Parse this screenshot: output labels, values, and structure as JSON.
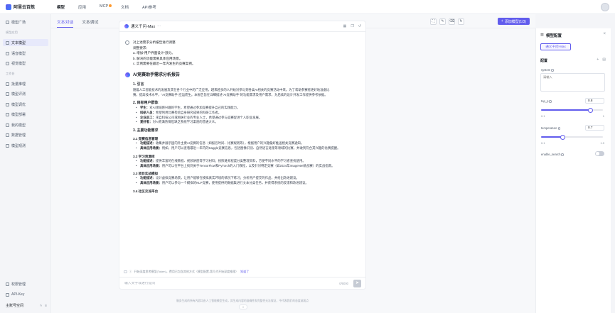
{
  "app": {
    "name": "阿里云百炼"
  },
  "topnav": [
    "模型",
    "应用",
    "MCP",
    "文档",
    "API参考"
  ],
  "sidebar": {
    "item_market": "模型广场",
    "section_debug": "模型应用",
    "debug_items": [
      "文本模型",
      "语音模型",
      "视觉模型"
    ],
    "section_tools": "工作台",
    "tool_items": [
      "批量推理",
      "模型评测",
      "模型调优",
      "模型部署",
      "我的模型",
      "数据管理",
      "模型观测"
    ],
    "footer_items": [
      "权限管理",
      "API-Key"
    ],
    "workspace": "主账号空间"
  },
  "tabs": [
    "文本对话",
    "文本调试"
  ],
  "toolbar": {
    "add_model_label": "添加模型(1/3)"
  },
  "chat": {
    "model_name": "通义千问-Max",
    "user_message": [
      "对上述需求分析报告进行调整",
      "调整要求：",
      "a. 增加\"用户界面设计\"部分。",
      "b. 解决的功能需要具体应用场景。",
      "c. 实例需要在最近一年内发生的竞赛案例。"
    ],
    "ai": {
      "title": "AI竞赛助手需求分析报告",
      "s1": "1. 引言",
      "s1_text": [
        "随着人工智能技术的发展及其在各个行业中的广泛应用，越来越多的人开始对参与到各类AI相关的竞赛活动中来。为了帮助参赛者更好地准备比",
        "赛，提高技术水平，\"AI竞赛助手\"应运而生。本报告旨在详细描述\"AI竞赛助手\"的功能需求及用户需求，为后续的设计开发工作提供参考依据。"
      ],
      "s2": "2. 目标用户群体",
      "s2_items": [
        {
          "k": "学生：",
          "v": "对AI领域感兴趣的学生，希望通过参加竞赛提升自己的实践能力。"
        },
        {
          "k": "科研人员：",
          "v": "希望利用比赛检验自身研究成果的科研工作者。"
        },
        {
          "k": "企业员工：",
          "v": "来自科技公司或相关行业的专业人士，希望通过参与竞赛促进个人职业发展。"
        },
        {
          "k": "爱好者：",
          "v": "对AI充满热情但缺乏系统学习渠道的普通大众。"
        }
      ],
      "s3": "3. 主要功能需求",
      "s31": "3.1 竞赛信息管理",
      "s31_items": [
        {
          "k": "功能描述：",
          "v": "收集并展示国内外主要AI竞赛的信息（如报名时间、比赛规则等），根据用户的兴趣偏好推送相关竞赛通知。"
        },
        {
          "k": "具体应用场景：",
          "v": "例如，用户可以查看最近一年内的Kaggle竞赛信息，包括图像识别、自然语言处理等领域的比赛，并收到符合其兴趣的比赛提醒。"
        }
      ],
      "s32": "3.2 学习资源库",
      "s32_items": [
        {
          "k": "功能描述：",
          "v": "提供丰富的在线教程、视频讲座等学习材料；按照难易程度分类整理资料，方便不同水平的学习者查找使用。"
        },
        {
          "k": "具体应用场景：",
          "v": "用户可以在平台上找到关于TensorFlow和PyTorch的入门教程，以及针对特定竞赛（如2024年ImageNet挑战赛）的实战指南。"
        }
      ],
      "s33": "3.3 项目实战模拟",
      "s33_items": [
        {
          "k": "功能描述：",
          "v": "设计虚拟竞赛场景，让用户能够在模拟真实环境的情况下练习；分析用户提交的作品，并给出改进建议。"
        },
        {
          "k": "具体应用场景：",
          "v": "用户可以参与一个模拟的NLP竞赛，使用提供的数据集进行文本分类任务，并获得系统的反馈和改进建议。"
        }
      ],
      "s34": "3.4 社区交流平台"
    },
    "tip_text": "开始深度思考模型(Token)，费用已包含其他方式（模型配置-第几代开始深度推理）",
    "tip_link": "知道了",
    "input_placeholder": "输入文字或进行提问",
    "counter": "0/6000",
    "disclaimer": "服务生成的所有内容均由人工智能模型生成，其生成内容的准确性和完整性无法保证，不代表我们的态度或观点"
  },
  "config": {
    "title": "模型配置",
    "model_chip": "通义千问-Max",
    "section": "配置",
    "system_label": "system",
    "system_placeholder": "请输入",
    "top_p": {
      "label": "top_p",
      "value": "0.8",
      "min": "0.1",
      "max": "1",
      "fraction": 0.8
    },
    "temperature": {
      "label": "temperature",
      "value": "0.7",
      "min": "0.1",
      "max": "1.9",
      "fraction": 0.35
    },
    "enable_search": {
      "label": "enable_search",
      "on": false
    }
  },
  "colors": {
    "accent": "#615ced",
    "background": "#f4f5f8"
  }
}
